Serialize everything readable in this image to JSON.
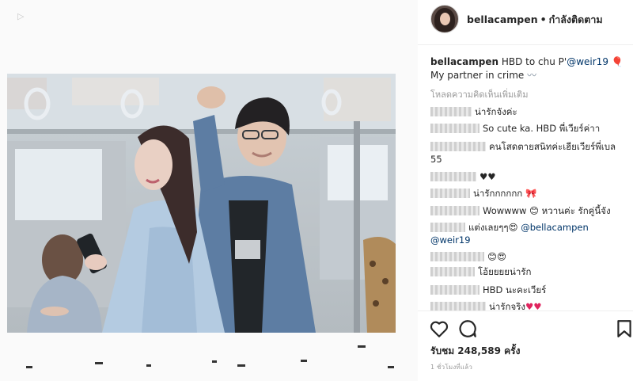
{
  "header": {
    "username": "bellacampen",
    "separator": "•",
    "follow_status": "กำลังติดตาม"
  },
  "caption": {
    "username": "bellacampen",
    "text": "HBD to chu P'",
    "mention": "@weir19",
    "text2": "My partner in crime"
  },
  "load_more": "โหลดความคิดเห็นเพิ่มเติม",
  "comments": [
    {
      "text": "น่ารักจังค่ะ"
    },
    {
      "text": "So cute ka. HBD พี่เวียร์ค่าา"
    },
    {
      "text": "คนโสดตายสนิทค่ะเฮียเวียร์พี่เบล 55"
    },
    {
      "text": "♥♥"
    },
    {
      "text": "น่ารักกกกกก"
    },
    {
      "text": "Wowwww 😊 หวานค่ะ รักคู่นี้จัง"
    },
    {
      "text": "แต่งเลยๆๆ😍 ",
      "mention": "@bellacampen",
      "mention2": "@weir19"
    },
    {
      "text": "😊😍"
    },
    {
      "text": "โอ้ยยยยน่ารัก"
    },
    {
      "text": "HBD นะคะเวียร์"
    },
    {
      "text": "น่ารักจริง",
      "hearts": "♥♥"
    }
  ],
  "views": "รับชม 248,589 ครั้ง",
  "time": "1 ชั่วโมงที่แล้ว",
  "icons": [
    "play-icon",
    "heart-icon",
    "comment-icon",
    "bookmark-icon"
  ]
}
